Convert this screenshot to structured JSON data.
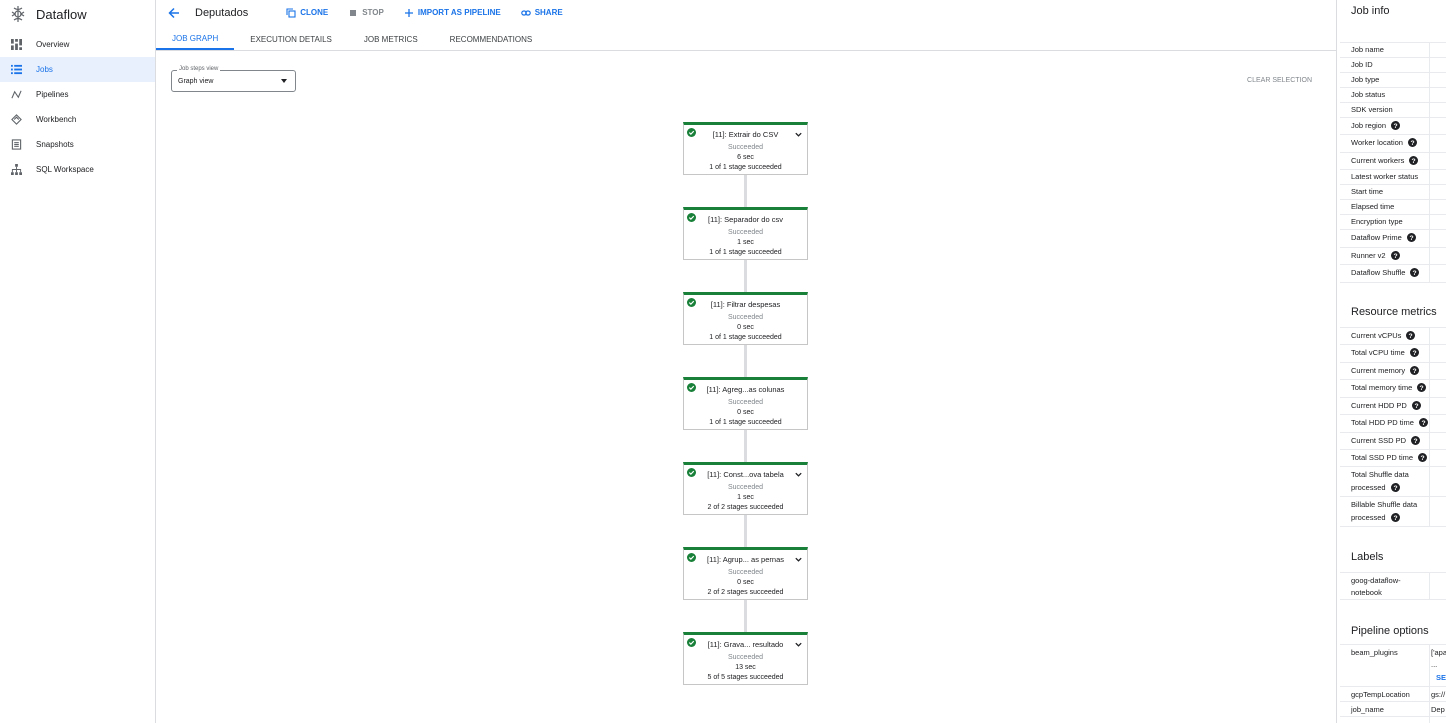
{
  "app": {
    "title": "Dataflow"
  },
  "sidebar": {
    "items": [
      {
        "label": "Overview",
        "icon": "dashboard-icon",
        "active": false
      },
      {
        "label": "Jobs",
        "icon": "list-icon",
        "active": true
      },
      {
        "label": "Pipelines",
        "icon": "pipelines-icon",
        "active": false
      },
      {
        "label": "Workbench",
        "icon": "workbench-icon",
        "active": false
      },
      {
        "label": "Snapshots",
        "icon": "snapshots-icon",
        "active": false
      },
      {
        "label": "SQL Workspace",
        "icon": "sql-workspace-icon",
        "active": false
      }
    ]
  },
  "header": {
    "job_title": "Deputados",
    "clone": "CLONE",
    "stop": "STOP",
    "import": "IMPORT AS PIPELINE",
    "share": "SHARE"
  },
  "tabs": [
    {
      "label": "JOB GRAPH",
      "active": true
    },
    {
      "label": "EXECUTION DETAILS",
      "active": false
    },
    {
      "label": "JOB METRICS",
      "active": false
    },
    {
      "label": "RECOMMENDATIONS",
      "active": false
    }
  ],
  "graph": {
    "steps_view_label": "Job steps view",
    "steps_view_value": "Graph view",
    "clear_selection": "CLEAR SELECTION",
    "nodes": [
      {
        "name": "[11]: Extrair do CSV",
        "status": "Succeeded",
        "time": "6 sec",
        "stages": "1 of 1 stage succeeded"
      },
      {
        "name": "[11]: Separador do csv",
        "status": "Succeeded",
        "time": "1 sec",
        "stages": "1 of 1 stage succeeded"
      },
      {
        "name": "[11]: Filtrar despesas",
        "status": "Succeeded",
        "time": "0 sec",
        "stages": "1 of 1 stage succeeded"
      },
      {
        "name": "[11]: Agreg...as colunas",
        "status": "Succeeded",
        "time": "0 sec",
        "stages": "1 of 1 stage succeeded"
      },
      {
        "name": "[11]: Const...ova tabela",
        "status": "Succeeded",
        "time": "1 sec",
        "stages": "2 of 2 stages succeeded"
      },
      {
        "name": "[11]: Agrup... as pernas",
        "status": "Succeeded",
        "time": "0 sec",
        "stages": "2 of 2 stages succeeded"
      },
      {
        "name": "[11]: Grava... resultado",
        "status": "Succeeded",
        "time": "13 sec",
        "stages": "5 of 5 stages succeeded"
      }
    ]
  },
  "job_info": {
    "title": "Job info",
    "rows": [
      {
        "label": "Job name",
        "help": false
      },
      {
        "label": "Job ID",
        "help": false
      },
      {
        "label": "Job type",
        "help": false
      },
      {
        "label": "Job status",
        "help": false
      },
      {
        "label": "SDK version",
        "help": false
      },
      {
        "label": "Job region",
        "help": true
      },
      {
        "label": "Worker location",
        "help": true
      },
      {
        "label": "Current workers",
        "help": true
      },
      {
        "label": "Latest worker status",
        "help": false
      },
      {
        "label": "Start time",
        "help": false
      },
      {
        "label": "Elapsed time",
        "help": false
      },
      {
        "label": "Encryption type",
        "help": false
      },
      {
        "label": "Dataflow Prime",
        "help": true
      },
      {
        "label": "Runner v2",
        "help": true
      },
      {
        "label": "Dataflow Shuffle",
        "help": true
      }
    ]
  },
  "resource_metrics": {
    "title": "Resource metrics",
    "rows": [
      {
        "label": "Current vCPUs",
        "help": true
      },
      {
        "label": "Total vCPU time",
        "help": true
      },
      {
        "label": "Current memory",
        "help": true
      },
      {
        "label": "Total memory time",
        "help": true
      },
      {
        "label": "Current HDD PD",
        "help": true
      },
      {
        "label": "Total HDD PD time",
        "help": true
      },
      {
        "label": "Current SSD PD",
        "help": true
      },
      {
        "label": "Total SSD PD time",
        "help": true
      }
    ],
    "shuffle_processed_l1": "Total Shuffle data",
    "shuffle_processed_l2": "processed",
    "billable_shuffle_l1": "Billable Shuffle data",
    "billable_shuffle_l2": "processed"
  },
  "labels": {
    "title": "Labels",
    "label_l1": "goog-dataflow-",
    "label_l2": "notebook"
  },
  "pipeline_options": {
    "title": "Pipeline options",
    "beam_plugins_key": "beam_plugins",
    "beam_plugins_val": "['apa",
    "beam_plugins_more": "...",
    "see_more": "SE",
    "gcp_temp_key": "gcpTempLocation",
    "gcp_temp_val": "gs://",
    "job_name_key": "job_name",
    "job_name_val": "Dep"
  },
  "colors": {
    "accent": "#1a73e8",
    "success": "#188038",
    "active_bg": "#e8f0fe"
  }
}
